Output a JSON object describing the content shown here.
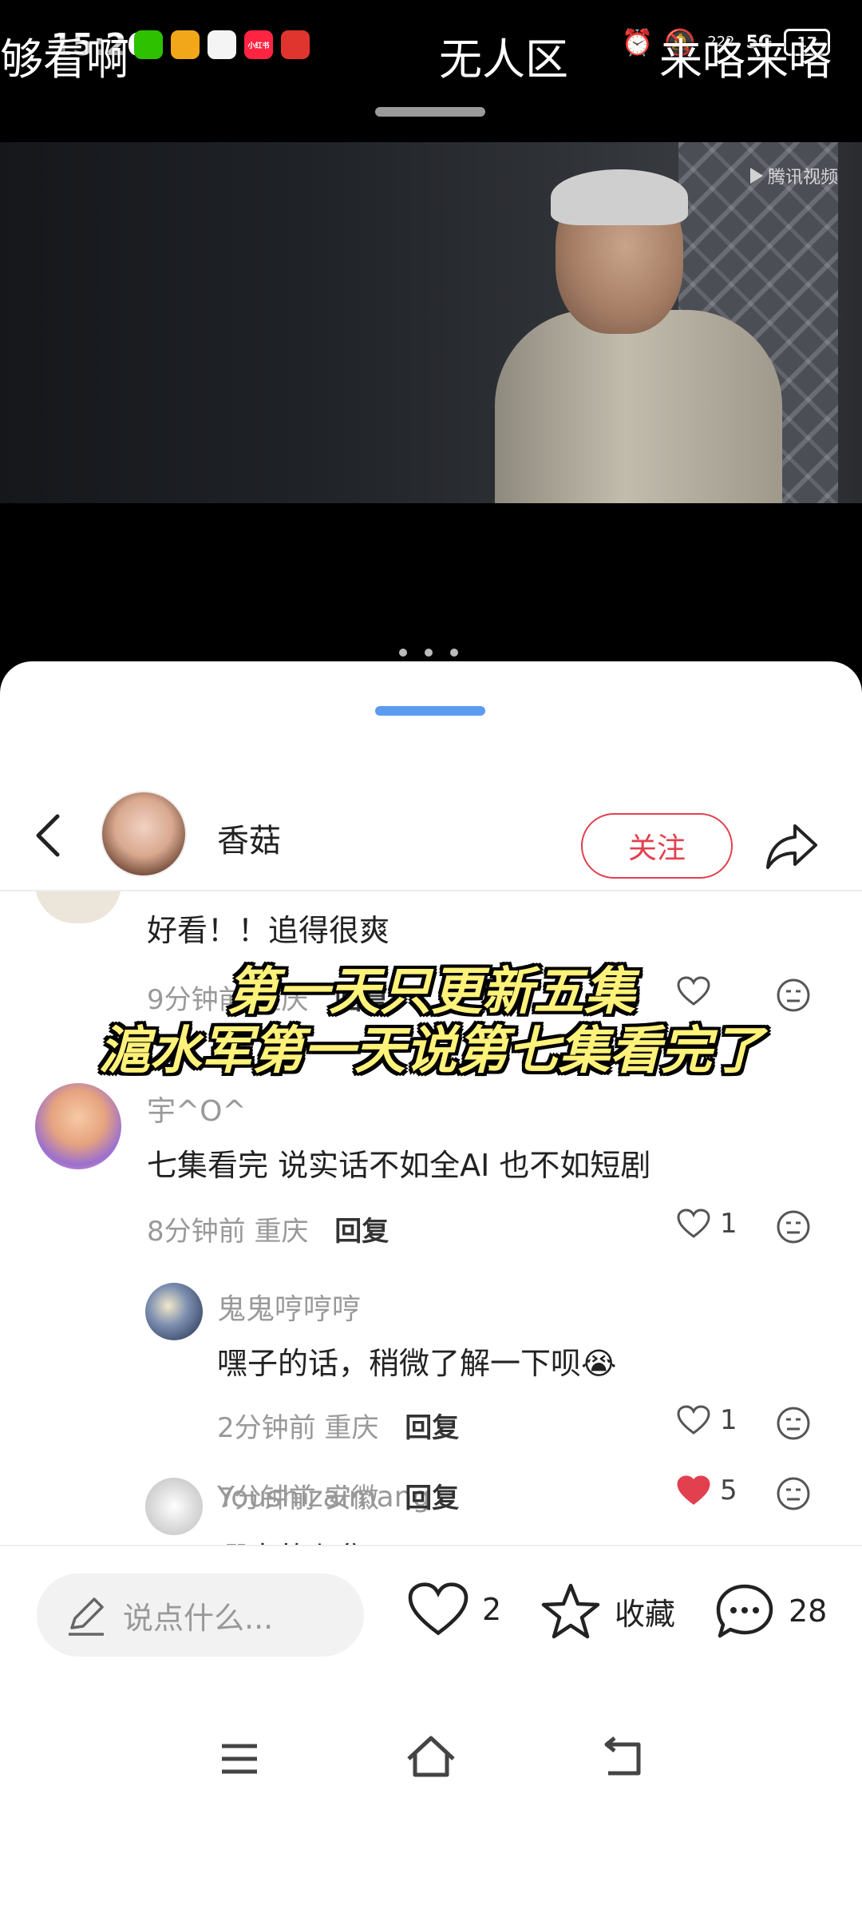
{
  "status_bar": {
    "time": "15:26",
    "app_icons": [
      {
        "name": "wechat-icon",
        "color": "#2dc100",
        "label": ""
      },
      {
        "name": "weibo-icon",
        "color": "#f2a71b",
        "label": ""
      },
      {
        "name": "avatar-app-icon",
        "color": "#f4f4f4",
        "label": ""
      },
      {
        "name": "xiaohongshu-icon",
        "color": "#ff2442",
        "label": "小红书"
      },
      {
        "name": "game-app-icon",
        "color": "#e0352f",
        "label": ""
      }
    ],
    "network": "5G",
    "speed": "222",
    "battery": "17"
  },
  "danmaku": [
    "够看啊",
    "无人区",
    "来咯来咯"
  ],
  "video": {
    "watermark": "腾讯视频"
  },
  "header": {
    "author_name": "香菇",
    "follow_label": "关注"
  },
  "overlay_caption": [
    "第一天只更新五集",
    "滬水军第一天说第七集看完了"
  ],
  "comments": [
    {
      "user": "",
      "text": "好看！！追得很爽",
      "time": "9分钟前",
      "location": "重庆",
      "reply_label": "回复",
      "likes": "",
      "liked": false
    },
    {
      "user": "宇^O^",
      "text": "七集看完  说实话不如全AI  也不如短剧",
      "time": "8分钟前",
      "location": "重庆",
      "reply_label": "回复",
      "likes": "1",
      "liked": false,
      "replies": [
        {
          "user": "鬼鬼哼哼哼",
          "text": "嘿子的话，稍微了解一下呗😭",
          "time": "2分钟前",
          "location": "重庆",
          "reply_label": "回复",
          "likes": "1",
          "liked": false
        },
        {
          "user": "Youshizaimang",
          "text": "哪来的七集？？？",
          "time": "7分钟前",
          "location": "安徽",
          "reply_label": "回复",
          "likes": "5",
          "liked": true
        }
      ]
    }
  ],
  "bottom_bar": {
    "input_placeholder": "说点什么...",
    "like_count": "2",
    "collect_label": "收藏",
    "comment_count": "28"
  },
  "colors": {
    "accent_red": "#e2404f",
    "handle_blue": "#5b9bf0",
    "caption_yellow": "#fff27a"
  }
}
